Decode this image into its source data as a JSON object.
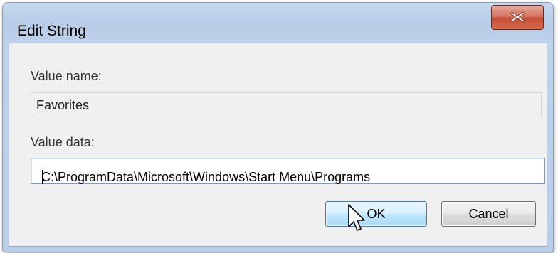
{
  "window": {
    "title": "Edit String",
    "close_icon": "close-x-icon"
  },
  "form": {
    "value_name_label": "Value name:",
    "value_name": "Favorites",
    "value_data_label": "Value data:",
    "value_data": "C:\\ProgramData\\Microsoft\\Windows\\Start Menu\\Programs"
  },
  "buttons": {
    "ok_label": "OK",
    "cancel_label": "Cancel"
  },
  "pointer": {
    "icon": "arrow-cursor-icon"
  },
  "colors": {
    "close_button": "#c44f37",
    "ok_button_border": "#3c7fb1",
    "frame": "#b9cee7"
  }
}
